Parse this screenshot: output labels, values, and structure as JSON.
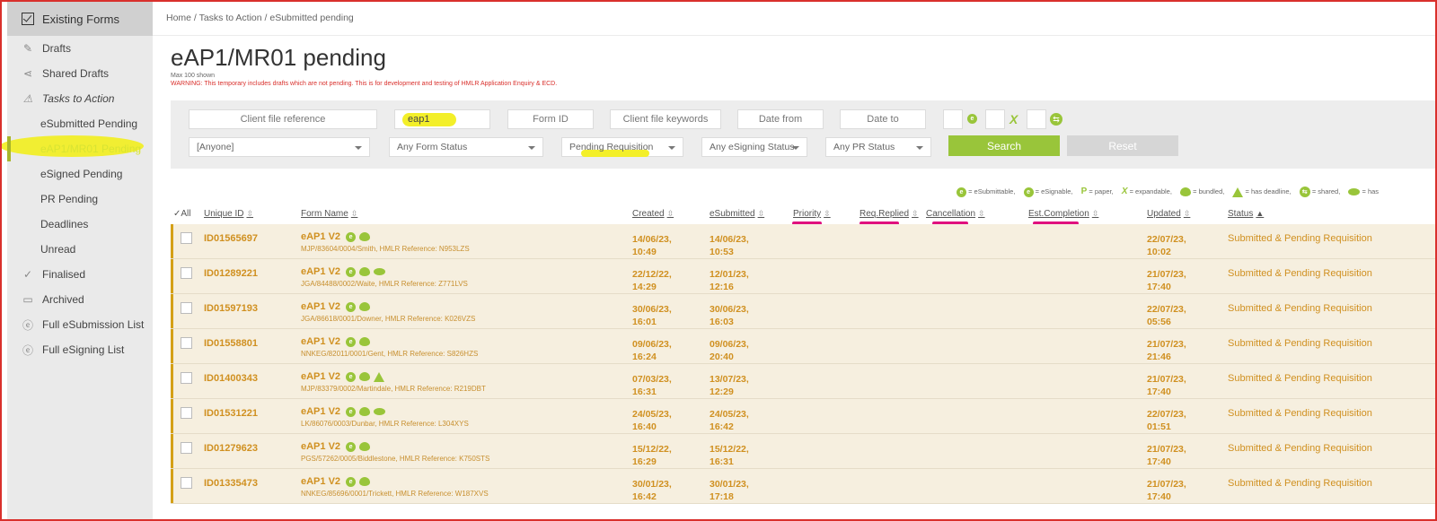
{
  "sidebar": {
    "header": "Existing Forms",
    "items": [
      {
        "label": "Drafts",
        "icon": "pencil-icon"
      },
      {
        "label": "Shared Drafts",
        "icon": "share-icon"
      },
      {
        "label": "Tasks to Action",
        "icon": "warning-icon"
      },
      {
        "label": "eSubmitted Pending"
      },
      {
        "label": "eAP1/MR01 Pending"
      },
      {
        "label": "eSigned Pending"
      },
      {
        "label": "PR Pending"
      },
      {
        "label": "Deadlines"
      },
      {
        "label": "Unread"
      },
      {
        "label": "Finalised",
        "icon": "check-icon"
      },
      {
        "label": "Archived",
        "icon": "folder-icon"
      },
      {
        "label": "Full eSubmission List",
        "icon": "e-circle-icon"
      },
      {
        "label": "Full eSigning List",
        "icon": "e-circle-icon"
      }
    ]
  },
  "breadcrumb": "Home / Tasks to Action / eSubmitted pending",
  "page": {
    "title": "eAP1/MR01 pending",
    "subtitle": "Max 100 shown",
    "warning": "WARNING: This temporary includes drafts which are not pending. This is for development and testing of HMLR Application Enquiry & ECD."
  },
  "filters": {
    "client_ref_placeholder": "Client file reference",
    "search_value": "eap1",
    "form_id_placeholder": "Form ID",
    "keywords_placeholder": "Client file keywords",
    "date_from_placeholder": "Date from",
    "date_to_placeholder": "Date to",
    "user_select": "[Anyone]",
    "form_status_select": "Any Form Status",
    "requisition_select": "Pending Requisition",
    "esigning_select": "Any eSigning Status",
    "pr_select": "Any PR Status",
    "search_label": "Search",
    "reset_label": "Reset",
    "toggle_e": "e",
    "toggle_x": "X"
  },
  "legend": [
    {
      "glyph": "e",
      "text": "= eSubmittable,"
    },
    {
      "glyph": "e",
      "text": "= eSignable,"
    },
    {
      "glyph": "P",
      "text": "= paper,"
    },
    {
      "glyph": "X",
      "text": "= expandable,"
    },
    {
      "glyph": "",
      "text": "= bundled,"
    },
    {
      "glyph": "",
      "text": "= has deadline,"
    },
    {
      "glyph": "",
      "text": "= shared,"
    },
    {
      "glyph": "",
      "text": "= has"
    }
  ],
  "table": {
    "headers": {
      "all": "All",
      "uid": "Unique ID",
      "form": "Form Name",
      "created": "Created",
      "esubmitted": "eSubmitted",
      "priority": "Priority",
      "replied": "Req.Replied",
      "cancellation": "Cancellation",
      "estcomp": "Est.Completion",
      "updated": "Updated",
      "status": "Status"
    },
    "rows": [
      {
        "id": "ID01565697",
        "form": "eAP1 V2",
        "ref": "MJP/83604/0004/Smith, HMLR Reference: N953LZS",
        "created1": "14/06/23,",
        "created2": "10:49",
        "esub1": "14/06/23,",
        "esub2": "10:53",
        "upd1": "22/07/23,",
        "upd2": "10:02",
        "status": "Submitted & Pending Requisition"
      },
      {
        "id": "ID01289221",
        "form": "eAP1 V2",
        "ref": "JGA/84488/0002/Waite, HMLR Reference: Z771LVS",
        "created1": "22/12/22,",
        "created2": "14:29",
        "esub1": "12/01/23,",
        "esub2": "12:16",
        "upd1": "21/07/23,",
        "upd2": "17:40",
        "status": "Submitted & Pending Requisition"
      },
      {
        "id": "ID01597193",
        "form": "eAP1 V2",
        "ref": "JGA/86618/0001/Downer, HMLR Reference: K026VZS",
        "created1": "30/06/23,",
        "created2": "16:01",
        "esub1": "30/06/23,",
        "esub2": "16:03",
        "upd1": "22/07/23,",
        "upd2": "05:56",
        "status": "Submitted & Pending Requisition"
      },
      {
        "id": "ID01558801",
        "form": "eAP1 V2",
        "ref": "NNKEG/82011/0001/Gent, HMLR Reference: S826HZS",
        "created1": "09/06/23,",
        "created2": "16:24",
        "esub1": "09/06/23,",
        "esub2": "20:40",
        "upd1": "21/07/23,",
        "upd2": "21:46",
        "status": "Submitted & Pending Requisition"
      },
      {
        "id": "ID01400343",
        "form": "eAP1 V2",
        "ref": "MJP/83379/0002/Martindale, HMLR Reference: R219DBT",
        "created1": "07/03/23,",
        "created2": "16:31",
        "esub1": "13/07/23,",
        "esub2": "12:29",
        "upd1": "21/07/23,",
        "upd2": "17:40",
        "status": "Submitted & Pending Requisition"
      },
      {
        "id": "ID01531221",
        "form": "eAP1 V2",
        "ref": "LK/86076/0003/Dunbar, HMLR Reference: L304XYS",
        "created1": "24/05/23,",
        "created2": "16:40",
        "esub1": "24/05/23,",
        "esub2": "16:42",
        "upd1": "22/07/23,",
        "upd2": "01:51",
        "status": "Submitted & Pending Requisition"
      },
      {
        "id": "ID01279623",
        "form": "eAP1 V2",
        "ref": "PGS/57262/0005/Biddlestone, HMLR Reference: K750STS",
        "created1": "15/12/22,",
        "created2": "16:29",
        "esub1": "15/12/22,",
        "esub2": "16:31",
        "upd1": "21/07/23,",
        "upd2": "17:40",
        "status": "Submitted & Pending Requisition"
      },
      {
        "id": "ID01335473",
        "form": "eAP1 V2",
        "ref": "NNKEG/85696/0001/Trickett, HMLR Reference: W187XVS",
        "created1": "30/01/23,",
        "created2": "16:42",
        "esub1": "30/01/23,",
        "esub2": "17:18",
        "upd1": "21/07/23,",
        "upd2": "17:40",
        "status": "Submitted & Pending Requisition"
      }
    ]
  },
  "colors": {
    "accent_green": "#99c53a",
    "row_text": "#d09020",
    "row_bg": "#f6efdf",
    "warning": "#d9302c",
    "highlight_yellow": "#f2ee1e",
    "annotation_pink": "#e0107e"
  }
}
